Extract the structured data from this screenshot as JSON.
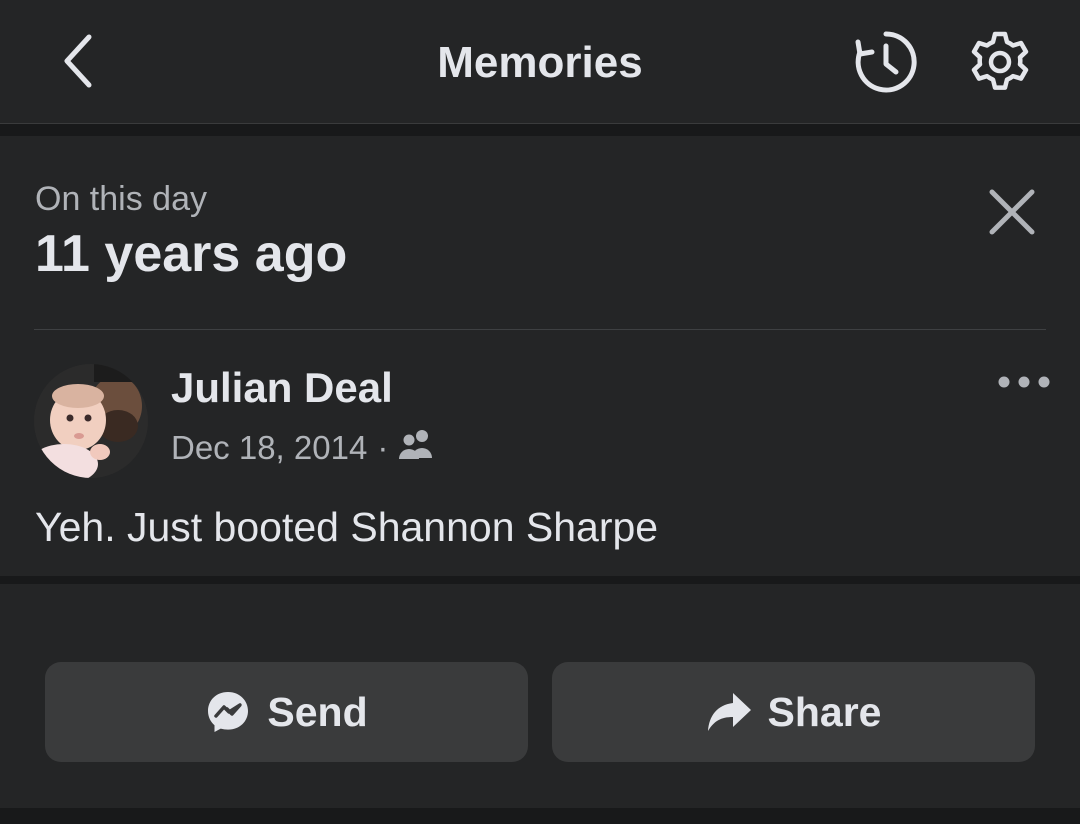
{
  "header": {
    "title": "Memories",
    "back_icon": "chevron-left-icon",
    "history_icon": "history-icon",
    "settings_icon": "gear-icon"
  },
  "memory": {
    "subtitle": "On this day",
    "headline": "11 years ago",
    "close_icon": "close-icon"
  },
  "post": {
    "author": "Julian Deal",
    "date": "Dec 18, 2014",
    "separator": "·",
    "audience_icon": "friends-icon",
    "more_icon": "more-horizontal-icon",
    "text": "Yeh. Just booted Shannon Sharpe"
  },
  "actions": {
    "send_label": "Send",
    "send_icon": "messenger-icon",
    "share_label": "Share",
    "share_icon": "share-arrow-icon"
  },
  "colors": {
    "background": "#18191a",
    "surface": "#242526",
    "button": "#3a3b3c",
    "text_primary": "#e4e6eb",
    "text_secondary": "#b0b3b8"
  }
}
